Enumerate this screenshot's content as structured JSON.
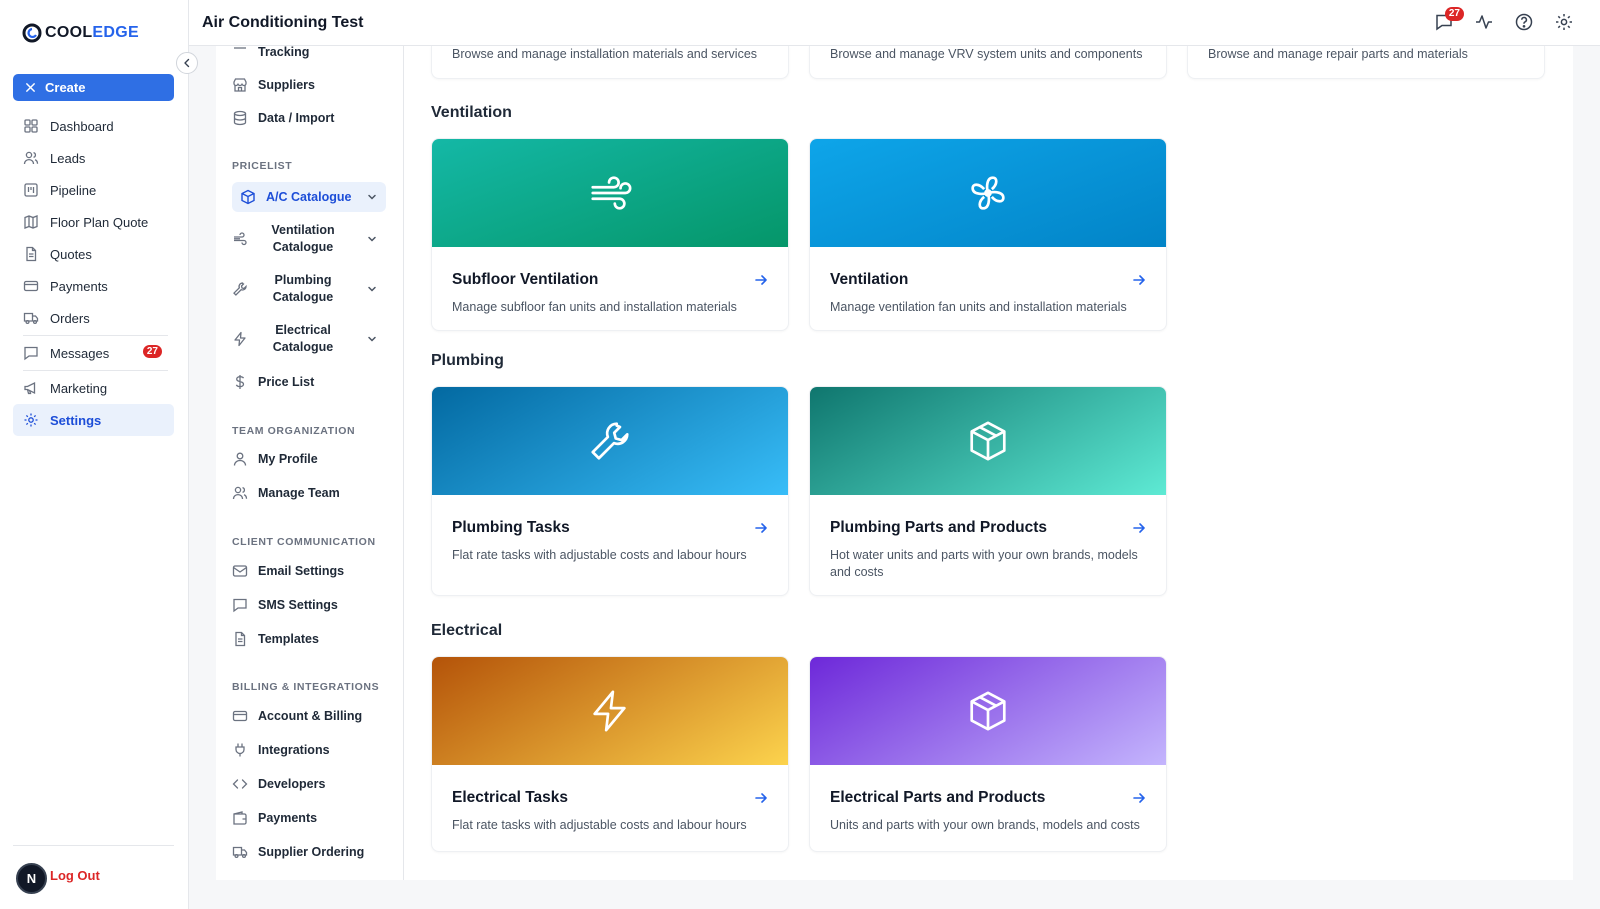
{
  "app": {
    "logo_cool": "COOL",
    "logo_edge": "EDGE",
    "page_title": "Air Conditioning Test",
    "brand_color": "#2563eb"
  },
  "sidebar": {
    "create_label": "Create",
    "items": [
      {
        "label": "Dashboard",
        "icon": "grid-icon"
      },
      {
        "label": "Leads",
        "icon": "users-icon"
      },
      {
        "label": "Pipeline",
        "icon": "kanban-icon"
      },
      {
        "label": "Floor Plan Quote",
        "icon": "map-icon"
      },
      {
        "label": "Quotes",
        "icon": "file-icon"
      },
      {
        "label": "Payments",
        "icon": "card-icon"
      },
      {
        "label": "Orders",
        "icon": "truck-icon"
      },
      {
        "label": "Messages",
        "icon": "message-icon",
        "badge": "27"
      },
      {
        "label": "Marketing",
        "icon": "megaphone-icon"
      },
      {
        "label": "Settings",
        "icon": "gear-icon",
        "active": true
      }
    ],
    "avatar_initial": "N",
    "logout_label": "Log Out"
  },
  "topbar": {
    "notification_count": "27"
  },
  "panel": {
    "top_items": [
      {
        "label": "Tracking"
      },
      {
        "label": "Suppliers"
      },
      {
        "label": "Data / Import"
      }
    ],
    "pricelist_heading": "PRICELIST",
    "pricelist_items": {
      "ac": "A/C Catalogue",
      "vent_1": "Ventilation",
      "vent_2": "Catalogue",
      "plumb_1": "Plumbing",
      "plumb_2": "Catalogue",
      "elec_1": "Electrical",
      "elec_2": "Catalogue",
      "price_list": "Price List"
    },
    "team_heading": "TEAM ORGANIZATION",
    "team_items": {
      "profile": "My Profile",
      "team": "Manage Team"
    },
    "client_heading": "CLIENT COMMUNICATION",
    "client_items": {
      "email": "Email Settings",
      "sms": "SMS Settings",
      "templates": "Templates"
    },
    "billing_heading": "BILLING & INTEGRATIONS",
    "billing_items": {
      "account": "Account & Billing",
      "integrations": "Integrations",
      "developers": "Developers",
      "payments": "Payments",
      "supplier": "Supplier Ordering"
    }
  },
  "main": {
    "top_partial": [
      "Browse and manage installation materials and services",
      "Browse and manage VRV system units and components",
      "Browse and manage repair parts and materials"
    ],
    "ventilation": {
      "title": "Ventilation",
      "cards": [
        {
          "title": "Subfloor Ventilation",
          "desc": "Manage subfloor fan units and installation materials",
          "icon": "wind-icon",
          "gradient": [
            "#14b8a6",
            "#059669"
          ]
        },
        {
          "title": "Ventilation",
          "desc": "Manage ventilation fan units and installation materials",
          "icon": "fan-icon",
          "gradient": [
            "#0ea5e9",
            "#0284c7"
          ]
        }
      ]
    },
    "plumbing": {
      "title": "Plumbing",
      "cards": [
        {
          "title": "Plumbing Tasks",
          "desc": "Flat rate tasks with adjustable costs and labour hours",
          "icon": "wrench-icon",
          "gradient": [
            "#0369a1",
            "#38bdf8"
          ]
        },
        {
          "title": "Plumbing Parts and Products",
          "desc": "Hot water units and parts with your own brands, models and costs",
          "icon": "box-icon",
          "gradient": [
            "#0f766e",
            "#5eead4"
          ]
        }
      ]
    },
    "electrical": {
      "title": "Electrical",
      "cards": [
        {
          "title": "Electrical Tasks",
          "desc": "Flat rate tasks with adjustable costs and labour hours",
          "icon": "bolt-icon",
          "gradient": [
            "#b45309",
            "#fcd34d"
          ]
        },
        {
          "title": "Electrical Parts and Products",
          "desc": "Units and parts with your own brands, models and costs",
          "icon": "box-icon",
          "gradient": [
            "#6d28d9",
            "#c4b5fd"
          ]
        }
      ]
    }
  }
}
